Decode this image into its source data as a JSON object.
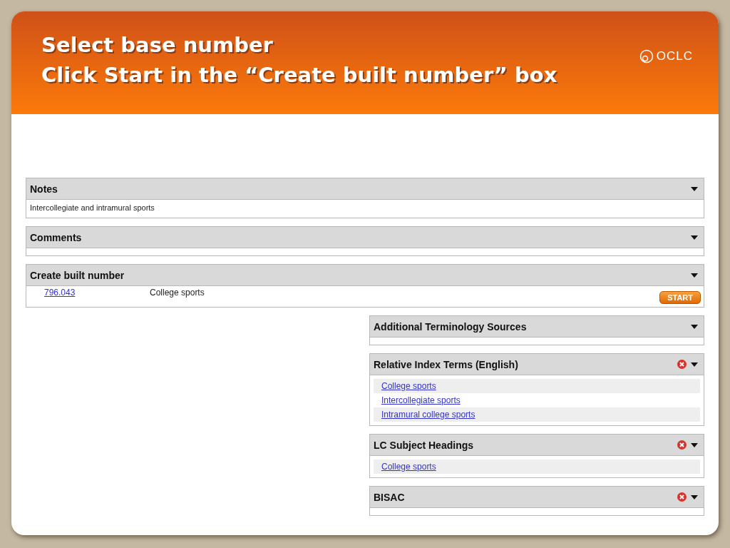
{
  "slide": {
    "title_lines": [
      "Select base number",
      "Click Start in the “Create built number” box"
    ],
    "logo": "OCLC"
  },
  "main_panels": [
    {
      "kind": "text",
      "title": "Notes",
      "text": "Intercollegiate and intramural sports"
    },
    {
      "kind": "empty",
      "title": "Comments"
    },
    {
      "kind": "build",
      "title": "Create built number",
      "number": "796.043",
      "caption": "College sports",
      "button": "START"
    }
  ],
  "side_panels": [
    {
      "title": "Additional Terminology Sources",
      "removable": false
    },
    {
      "title": "Relative Index Terms (English)",
      "removable": true,
      "links": [
        "College sports",
        "Intercollegiate sports",
        "Intramural college sports"
      ]
    },
    {
      "title": "LC Subject Headings",
      "removable": true,
      "links": [
        "College sports"
      ]
    },
    {
      "title": "BISAC",
      "removable": true
    }
  ]
}
